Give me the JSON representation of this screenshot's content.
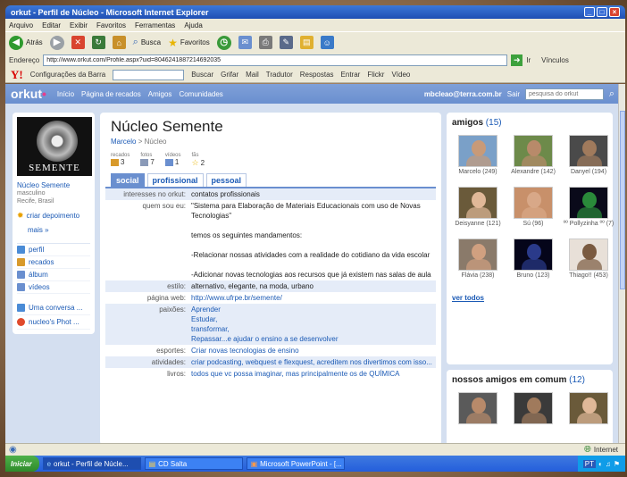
{
  "window": {
    "title": "orkut - Perfil de Núcleo - Microsoft Internet Explorer"
  },
  "menu": [
    "Arquivo",
    "Editar",
    "Exibir",
    "Favoritos",
    "Ferramentas",
    "Ajuda"
  ],
  "toolbar": {
    "back": "Atrás",
    "search": "Busca",
    "favorites": "Favoritos"
  },
  "address": {
    "label": "Endereço",
    "url": "http://www.orkut.com/Profile.aspx?uid=8046241887214692035",
    "go": "Ir",
    "links": "Vínculos"
  },
  "yahoo": {
    "logo": "Y!",
    "settings": "Configurações da Barra",
    "search": "Buscar",
    "highlight": "Grifar",
    "mail": "Mail",
    "translator": "Tradutor",
    "answers": "Respostas",
    "enter": "Entrar",
    "flickr": "Flickr",
    "video": "Vídeo"
  },
  "orkut_nav": {
    "logo": "orkut",
    "links": [
      "Início",
      "Página de recados",
      "Amigos",
      "Comunidades"
    ],
    "email": "mbcleao@terra.com.br",
    "logout": "Sair",
    "search_placeholder": "pesquisa do orkut"
  },
  "sidebar": {
    "name": "Núcleo Semente",
    "gender": "masculino",
    "location": "Recife, Brasil",
    "photo_caption": "SEMENTE",
    "create_testimonial": "criar depoimento",
    "more": "mais »",
    "menu": [
      {
        "label": "perfil",
        "icon": "profile-icon",
        "color": "#4a8bd6"
      },
      {
        "label": "recados",
        "icon": "scraps-icon",
        "color": "#d89a2c"
      },
      {
        "label": "álbum",
        "icon": "album-icon",
        "color": "#6a8fcf"
      },
      {
        "label": "vídeos",
        "icon": "video-icon",
        "color": "#6a8fcf"
      }
    ],
    "communities": [
      {
        "label": "Uma conversa ...",
        "icon": "community-icon",
        "color": "#4a8bd6"
      },
      {
        "label": "nucleo's Phot ...",
        "icon": "photo-community-icon",
        "color": "#e04a2c"
      }
    ]
  },
  "profile": {
    "title": "Núcleo Semente",
    "breadcrumb": {
      "root": "Marcelo",
      "sep": ">",
      "current": "Núcleo"
    },
    "stats": [
      {
        "label": "recados",
        "value": "3"
      },
      {
        "label": "fotos",
        "value": "7"
      },
      {
        "label": "vídeos",
        "value": "1"
      },
      {
        "label": "fãs",
        "value": "2"
      }
    ],
    "tabs": [
      "social",
      "profissional",
      "pessoal"
    ],
    "rows": [
      {
        "key": "interesses no orkut:",
        "value": "contatos profissionais",
        "link": false
      },
      {
        "key": "quem sou eu:",
        "value": "\"Sistema para Elaboração de Materiais Educacionais com uso de Novas Tecnologias\"\n\ntemos os seguintes mandamentos:\n\n-Relacionar nossas atividades com a realidade do cotidiano da vida escolar\n\n-Adicionar novas tecnologias aos recursos que já existem nas salas de aula",
        "link": false
      },
      {
        "key": "estilo:",
        "value": "alternativo, elegante, na moda, urbano",
        "link": false
      },
      {
        "key": "página web:",
        "value": "http://www.ufrpe.br/semente/",
        "link": true
      },
      {
        "key": "paixões:",
        "value": "Aprender\nEstudar,\ntransformar,\nRepassar...e ajudar o ensino a se desenvolver",
        "link": true
      },
      {
        "key": "esportes:",
        "value": "Criar novas tecnologias de ensino",
        "link": true
      },
      {
        "key": "atividades:",
        "value": "criar podcasting, webquest e flexquest, acreditem nos divertimos com isso...",
        "link": true
      },
      {
        "key": "livros:",
        "value": "todos que vc possa imaginar, mas principalmente os de QUÍMICA",
        "link": true
      }
    ]
  },
  "friends": {
    "title": "amigos",
    "count": "(15)",
    "items": [
      {
        "name": "Marcelo (249)",
        "skin": "#c89a78",
        "bg": "#7aa0c8"
      },
      {
        "name": "Alexandre (142)",
        "skin": "#b88a6a",
        "bg": "#6d8a4a"
      },
      {
        "name": "Danyel (194)",
        "skin": "#a07a5c",
        "bg": "#4a4a4a"
      },
      {
        "name": "Deisyanne (121)",
        "skin": "#e0b898",
        "bg": "#6a5a3a"
      },
      {
        "name": "Sú (96)",
        "skin": "#d8a888",
        "bg": "#c8906a"
      },
      {
        "name": "ºº Pollyzinha ºº (7)",
        "skin": "#2a8a3a",
        "bg": "#0a0a1a"
      },
      {
        "name": "Flávia (238)",
        "skin": "#d0a080",
        "bg": "#8a7a6a"
      },
      {
        "name": "Bruno (123)",
        "skin": "#2a3a8a",
        "bg": "#05051a"
      },
      {
        "name": "Thiago!! (453)",
        "skin": "#7a5a40",
        "bg": "#e8e0d8"
      }
    ],
    "see_all": "ver todos"
  },
  "common_friends": {
    "title": "nossos amigos em comum",
    "count": "(12)",
    "items": [
      {
        "skin": "#b88a6a",
        "bg": "#5a5a5a"
      },
      {
        "skin": "#a07a5c",
        "bg": "#3a3a3a"
      },
      {
        "skin": "#e0b898",
        "bg": "#6a5a3a"
      }
    ]
  },
  "statusbar": {
    "zone": "Internet"
  },
  "taskbar": {
    "start": "Iniciar",
    "tasks": [
      "orkut - Perfil de Núcle...",
      "CD Salta",
      "Microsoft PowerPoint - [..."
    ],
    "tray_lang": "PT"
  }
}
